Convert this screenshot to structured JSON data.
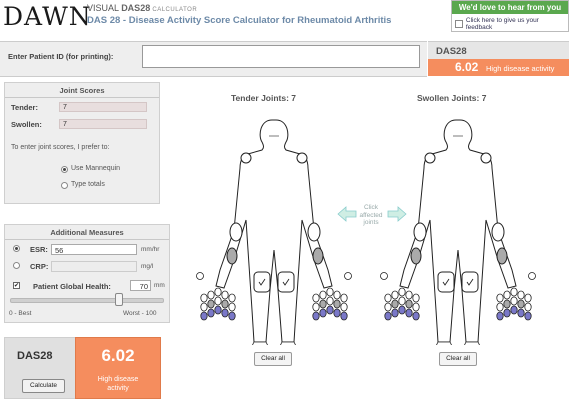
{
  "header": {
    "logo": "DAWN",
    "brand_prefix": "VISUAL ",
    "brand_name": "DAS28",
    "brand_suffix": " CALCULATOR",
    "title": "DAS 28 - Disease Activity Score Calculator for Rheumatoid Arthritis"
  },
  "feedback": {
    "heading": "We'd love to hear from you",
    "link": "Click here to give us your feedback"
  },
  "patient": {
    "label": "Enter Patient ID (for printing):",
    "value": ""
  },
  "das_top": {
    "label": "DAS28",
    "score": "6.02",
    "severity": "High disease activity"
  },
  "joint_scores": {
    "title": "Joint Scores",
    "tender_label": "Tender:",
    "tender_value": "7",
    "swollen_label": "Swollen:",
    "swollen_value": "7",
    "prefer_text": "To enter joint scores, I prefer to:",
    "options": [
      "Use Mannequin",
      "Type totals"
    ],
    "selected": "Use Mannequin"
  },
  "measures": {
    "title": "Additional Measures",
    "esr_label": "ESR:",
    "esr_value": "56",
    "esr_unit": "mm/hr",
    "crp_label": "CRP:",
    "crp_value": "",
    "crp_unit": "mg/l",
    "pgh_label": "Patient Global Health:",
    "pgh_value": "70",
    "pgh_unit": "mm",
    "pgh_level": 70,
    "scale_min": "0 - Best",
    "scale_max": "Worst - 100"
  },
  "das_bottom": {
    "label": "DAS28",
    "score": "6.02",
    "severity_line1": "High disease",
    "severity_line2": "activity",
    "calculate": "Calculate"
  },
  "mannequins": {
    "tender_title": "Tender Joints: 7",
    "swollen_title": "Swollen Joints: 7",
    "hint_line1": "Click",
    "hint_line2": "affected",
    "hint_line3": "joints",
    "clear_label": "Clear all"
  },
  "colors": {
    "orange": "#f58d5e",
    "green": "#5aa84e",
    "panel": "#eeeeee",
    "joint_selected": "#aaaaaa",
    "finger_blue": "#7a78c8"
  }
}
